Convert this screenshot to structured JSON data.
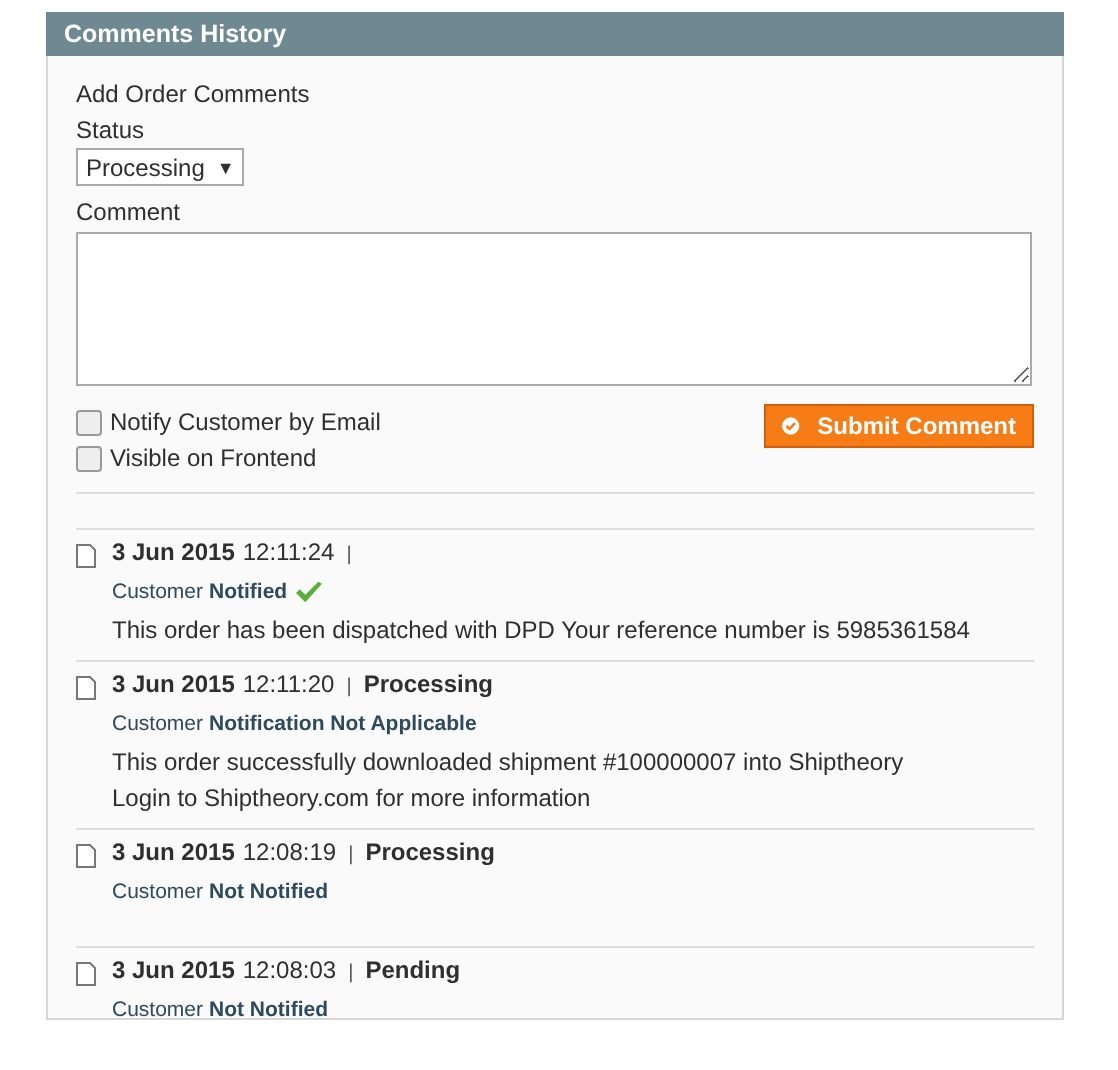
{
  "panel": {
    "title": "Comments History"
  },
  "form": {
    "heading": "Add Order Comments",
    "status_label": "Status",
    "status_value": "Processing",
    "status_caret": "▼",
    "comment_label": "Comment",
    "options": [
      {
        "label": "Notify Customer by Email",
        "checked": false
      },
      {
        "label": "Visible on Frontend",
        "checked": false
      }
    ],
    "submit": "Submit Comment"
  },
  "history": [
    {
      "date": "3 Jun 2015",
      "time": "12:11:24",
      "separator": "|",
      "customer": "Customer",
      "notification": "Notified",
      "notified": true,
      "lines": [
        "This order has been dispatched with DPD Your reference number is 5985361584"
      ]
    },
    {
      "date": "3 Jun 2015",
      "time": "12:11:20",
      "separator": "|",
      "status": "Processing",
      "customer": "Customer",
      "notification": "Notification Not Applicable",
      "notified": false,
      "lines": [
        "This order successfully downloaded shipment #100000007 into Shiptheory",
        "Login to Shiptheory.com for more information"
      ]
    },
    {
      "date": "3 Jun 2015",
      "time": "12:08:19",
      "separator": "|",
      "status": "Processing",
      "customer": "Customer",
      "notification": "Not Notified",
      "notified": false
    },
    {
      "date": "3 Jun 2015",
      "time": "12:08:03",
      "separator": "|",
      "status": "Pending",
      "customer": "Customer",
      "notification": "Not Notified",
      "notified": false
    }
  ]
}
